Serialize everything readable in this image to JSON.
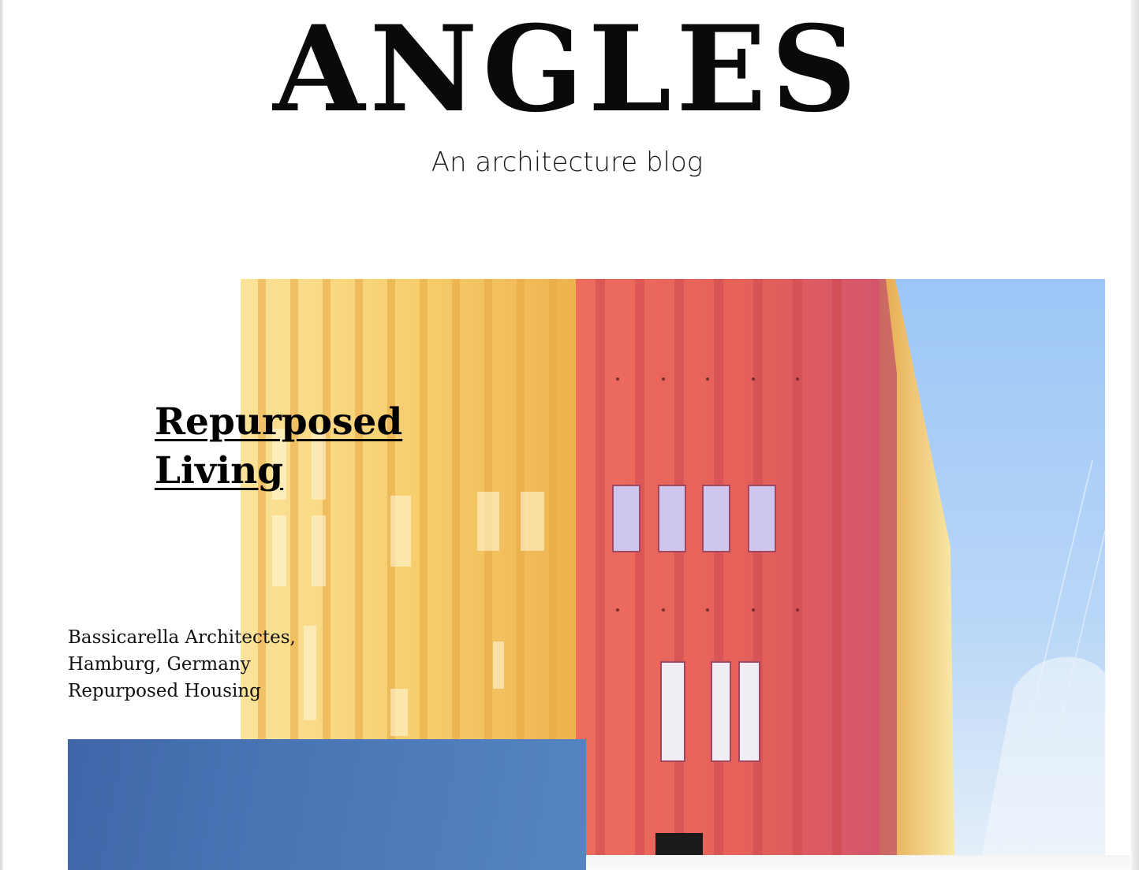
{
  "site": {
    "title": "ANGLES",
    "tagline": "An architecture blog"
  },
  "featured_post": {
    "title_line1": "Repurposed",
    "title_line2": "Living",
    "meta": {
      "architect": "Bassicarella Architectes,",
      "location": "Hamburg, Germany",
      "category": "Repurposed Housing"
    }
  },
  "colors": {
    "yellow_facade": "#f2c45a",
    "red_facade": "#e8665a",
    "sky": "#a9cdf6",
    "secondary_blue": "#4a75b5"
  }
}
